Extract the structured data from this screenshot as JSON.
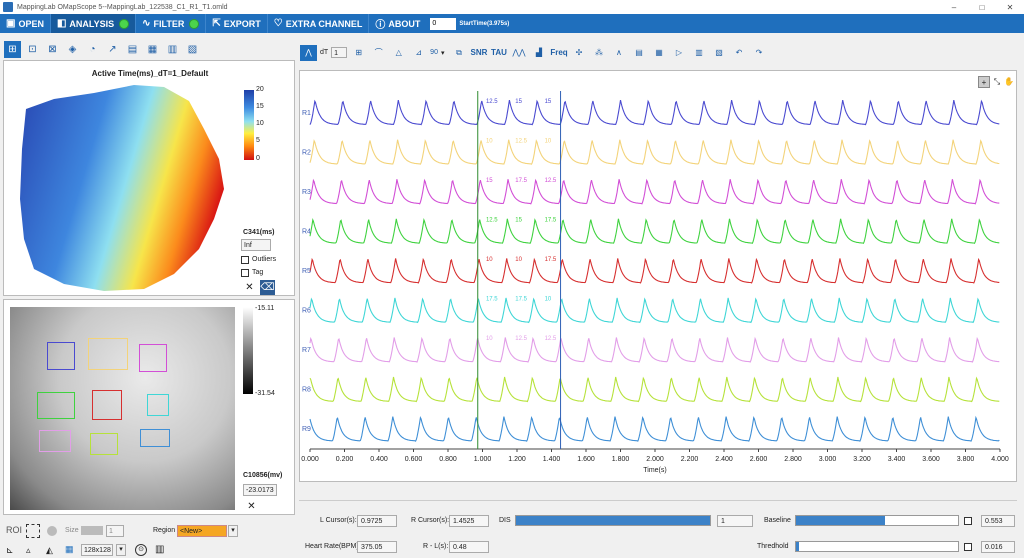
{
  "window": {
    "title": "MappingLab OMapScope 5--MappingLab_122538_C1_R1_T1.omld",
    "controls": [
      "–",
      "□",
      "✕"
    ]
  },
  "menu": {
    "open": "OPEN",
    "analysis": "ANALYSIS",
    "filter": "FILTER",
    "export": "EXPORT",
    "extra_channel": "EXTRA CHANNEL",
    "about": "ABOUT",
    "start_value": "0",
    "start_label": "StartTime(3.975s)"
  },
  "activation_map": {
    "title": "Active Time(ms)_dT=1_Default",
    "colorbar_ticks": [
      "20",
      "15",
      "10",
      "5",
      "0"
    ],
    "c_label": "C341(ms)",
    "c_value": "Inf",
    "outliers_label": "Outliers",
    "tag_label": "Tag"
  },
  "fluorescence": {
    "gray_ticks": [
      "-15.11",
      "-31.54"
    ],
    "c_label": "C10856(mv)",
    "c_value": "-23.0173"
  },
  "roi_controls": {
    "roi_label": "ROI",
    "size_label": "Size",
    "size_value": "1",
    "region_label": "Region",
    "region_value": "<New>",
    "resolution": "128x128"
  },
  "trace_toolbar": {
    "dt_value": "1",
    "angle_value": "90",
    "snr": "SNR",
    "tau": "TAU",
    "freq": "Freq"
  },
  "plot": {
    "xlabel": "Time(s)",
    "x_ticks": [
      "0.000",
      "0.200",
      "0.400",
      "0.600",
      "0.800",
      "1.000",
      "1.200",
      "1.400",
      "1.600",
      "1.800",
      "2.000",
      "2.200",
      "2.400",
      "2.600",
      "2.800",
      "3.000",
      "3.200",
      "3.400",
      "3.600",
      "3.800",
      "4.000"
    ],
    "traces": [
      {
        "name": "R1",
        "color": "#4a4ad0"
      },
      {
        "name": "R2",
        "color": "#f3d37a"
      },
      {
        "name": "R3",
        "color": "#d24fd6"
      },
      {
        "name": "R4",
        "color": "#3fd23f"
      },
      {
        "name": "R5",
        "color": "#d62f2f"
      },
      {
        "name": "R6",
        "color": "#3fd6d6"
      },
      {
        "name": "R7",
        "color": "#e29ee8"
      },
      {
        "name": "R8",
        "color": "#b6e23a"
      },
      {
        "name": "R9",
        "color": "#3f8fd6"
      }
    ],
    "peak_labels": [
      "12.5",
      "15",
      "15",
      "10",
      "12.5",
      "10",
      "15",
      "17.5",
      "12.5",
      "12.5",
      "15",
      "17.5",
      "10",
      "10",
      "17.5",
      "17.5",
      "17.5",
      "10",
      "10",
      "12.5",
      "12.5"
    ],
    "cursor_left_s": 0.9725,
    "cursor_right_s": 1.4525
  },
  "measures": {
    "l_cursor_label": "L Cursor(s):",
    "l_cursor": "0.9725",
    "r_cursor_label": "R Cursor(s):",
    "r_cursor": "1.4525",
    "dis_label": "DIS",
    "dis_value": "1",
    "dis_fill": 1.0,
    "baseline_label": "Baseline",
    "baseline_value": "0.553",
    "baseline_fill": 0.55,
    "hr_label": "Heart Rate(BPM):",
    "hr_value": "375.05",
    "rl_label": "R - L(s):",
    "rl_value": "0.48",
    "threshold_label": "Thredhold",
    "threshold_value": "0.016",
    "threshold_fill": 0.016
  }
}
